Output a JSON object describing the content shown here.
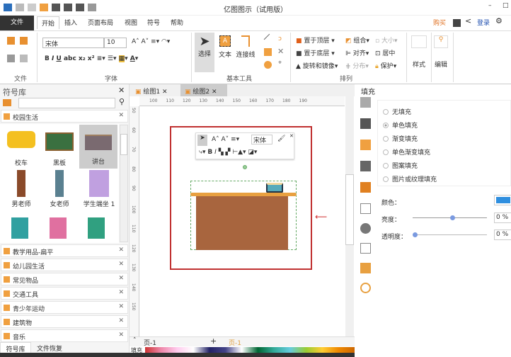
{
  "app": {
    "title": "亿图图示（试用版）",
    "minimize": "–",
    "maximize": "□"
  },
  "menu": {
    "file": "文件",
    "tabs": [
      "开始",
      "插入",
      "页面布局",
      "视图",
      "符号",
      "帮助"
    ],
    "buy": "购买",
    "login": "登录"
  },
  "ribbon": {
    "groups": [
      "文件",
      "字体",
      "基本工具",
      "排列"
    ],
    "font_name": "宋体",
    "font_size": "10",
    "tools": [
      "选择",
      "文本",
      "连接线"
    ],
    "arrange": [
      "置于顶层",
      "置于底层",
      "旋转和镜像",
      "组合",
      "对齐",
      "分布",
      "大小",
      "居中",
      "保护"
    ],
    "style": "样式",
    "edit": "编辑"
  },
  "library": {
    "title": "符号库",
    "search_placeholder": "",
    "current": "校园生活",
    "symbols": [
      "校车",
      "黑板",
      "讲台",
      "男老师",
      "女老师",
      "学生端坐 1"
    ],
    "categories": [
      "教学用品-扁平",
      "幼儿园生活",
      "常见物品",
      "交通工具",
      "青少年运动",
      "建筑物",
      "音乐"
    ],
    "bottom_tabs": [
      "符号库",
      "文件恢复"
    ]
  },
  "docs": {
    "tabs": [
      "绘图1",
      "绘图2"
    ]
  },
  "ruler": {
    "h": [
      "100",
      "110",
      "120",
      "130",
      "140",
      "150",
      "160",
      "170",
      "180",
      "190"
    ],
    "v": [
      "50",
      "60",
      "70",
      "80",
      "90",
      "100",
      "110",
      "120",
      "130",
      "140",
      "150"
    ]
  },
  "floating": {
    "font": "宋体"
  },
  "pages": {
    "current": "页-1",
    "tab": "页-1",
    "fill_label": "填充"
  },
  "fill": {
    "title": "填充",
    "options": [
      "无填充",
      "单色填充",
      "渐变填充",
      "单色渐变填充",
      "图案填充",
      "图片或纹理填充"
    ],
    "selected": "单色填充",
    "color_label": "颜色：",
    "color": "#2f8fdf",
    "brightness_label": "亮度：",
    "brightness": "0 %",
    "brightness_fraction": 0.5,
    "transparency_label": "透明度：",
    "transparency": "0 %",
    "transparency_fraction": 0
  }
}
